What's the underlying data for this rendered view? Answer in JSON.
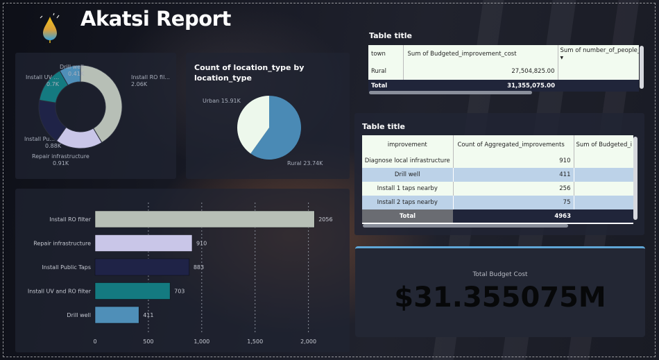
{
  "header": {
    "title": "Akatsi Report"
  },
  "donut": {
    "slices": [
      {
        "label": "Install RO fil...",
        "value_label": "2.06K",
        "value": 2056,
        "color": "#b7bfb6"
      },
      {
        "label": "Repair infrastructure",
        "value_label": "0.91K",
        "value": 910,
        "color": "#c9c6e8"
      },
      {
        "label": "Install Pu...",
        "value_label": "0.88K",
        "value": 883,
        "color": "#1f2347"
      },
      {
        "label": "Install UV ...",
        "value_label": "0.7K",
        "value": 703,
        "color": "#147a80"
      },
      {
        "label": "Drill well",
        "value_label": "0.41K",
        "value": 411,
        "color": "#4f8fb8"
      }
    ]
  },
  "pie": {
    "title": "Count of location_type by location_type",
    "slices": [
      {
        "label": "Rural 23.74K",
        "value": 23.74,
        "color": "#4a8ab5"
      },
      {
        "label": "Urban 15.91K",
        "value": 15.91,
        "color": "#edf8ec"
      }
    ]
  },
  "chart_data": {
    "type": "bar",
    "orientation": "horizontal",
    "categories": [
      "Install RO filter",
      "Repair infrastructure",
      "Install Public Taps",
      "Install UV and RO filter",
      "Drill well"
    ],
    "values": [
      2056,
      910,
      883,
      703,
      411
    ],
    "value_labels": [
      "2056",
      "910",
      "883",
      "703",
      "411"
    ],
    "colors": [
      "#b7bfb6",
      "#c9c6e8",
      "#1f2347",
      "#147a80",
      "#4f8fb8"
    ],
    "xticks": [
      0,
      500,
      1000,
      1500,
      2000
    ],
    "xtick_labels": [
      "0",
      "500",
      "1,000",
      "1,500",
      "2,000"
    ],
    "xlim": [
      0,
      2100
    ],
    "grid": true
  },
  "table1": {
    "title": "Table title",
    "columns": [
      "town",
      "Sum of Budgeted_improvement_cost",
      "Sum of number_of_people_"
    ],
    "rows": [
      [
        "Rural",
        "27,504,825.00",
        ""
      ]
    ],
    "total": [
      "Total",
      "31,355,075.00",
      ""
    ]
  },
  "table2": {
    "title": "Table title",
    "columns": [
      "improvement",
      "Count of Aggregated_improvements",
      "Sum of Budgeted_i"
    ],
    "rows": [
      [
        "Diagnose local infrastructure",
        "910",
        ""
      ],
      [
        "Drill well",
        "411",
        ""
      ],
      [
        "Install 1 taps nearby",
        "256",
        ""
      ],
      [
        "Install 2 taps nearby",
        "75",
        ""
      ]
    ],
    "total": [
      "Total",
      "4963",
      ""
    ]
  },
  "kpi": {
    "label": "Total Budget Cost",
    "value": "$31.355075M"
  },
  "colors": {
    "accent": "#5fa6d6",
    "panel": "#202432"
  }
}
